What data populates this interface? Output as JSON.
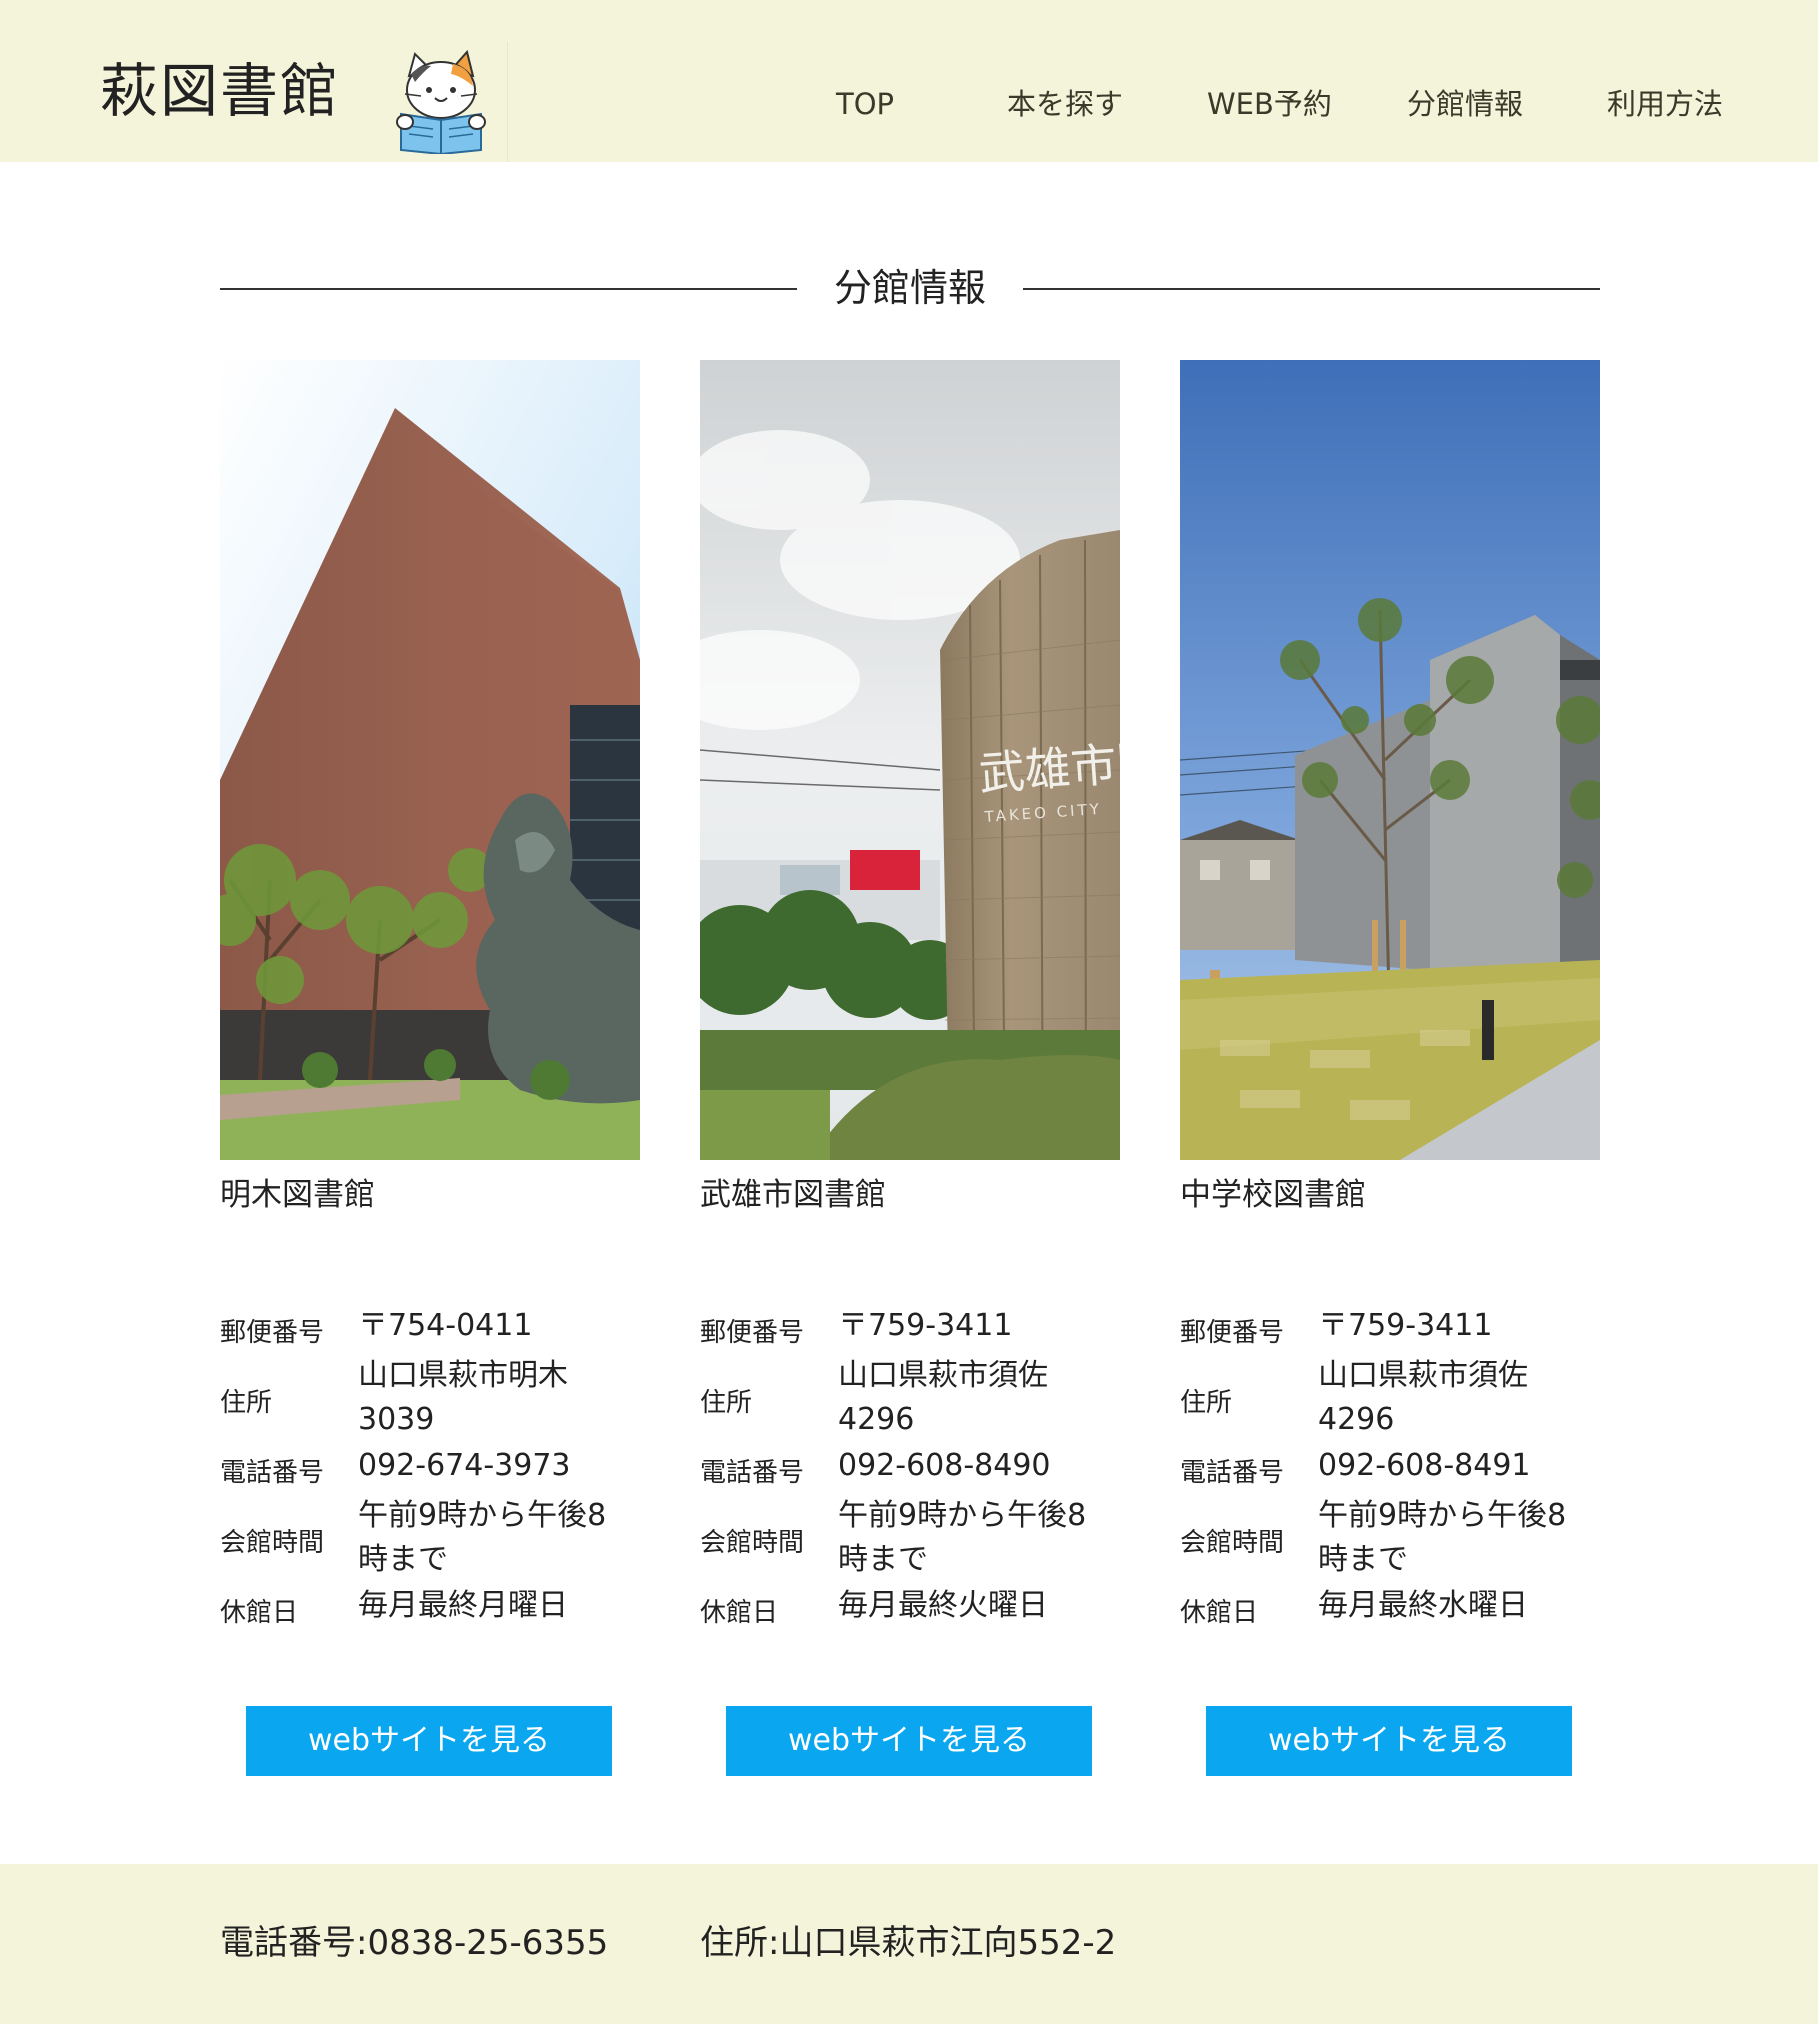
{
  "header": {
    "site_title": "萩図書館",
    "nav": [
      "TOP",
      "本を探す",
      "WEB予約",
      "分館情報",
      "利用方法"
    ]
  },
  "section": {
    "title": "分館情報"
  },
  "labels": {
    "postal": "郵便番号",
    "address": "住所",
    "phone": "電話番号",
    "hours": "会館時間",
    "closed": "休館日"
  },
  "libraries": [
    {
      "name": "明木図書館",
      "postal": "〒754-0411",
      "address": "山口県萩市明木3039",
      "phone": "092-674-3973",
      "hours": "午前9時から午後8時まで",
      "closed": "毎月最終月曜日",
      "button": "webサイトを見る"
    },
    {
      "name": "武雄市図書館",
      "postal": "〒759-3411",
      "address": "山口県萩市須佐4296",
      "phone": "092-608-8490",
      "hours": "午前9時から午後8時まで",
      "closed": "毎月最終火曜日",
      "button": "webサイトを見る"
    },
    {
      "name": "中学校図書館",
      "postal": "〒759-3411",
      "address": "山口県萩市須佐4296",
      "phone": "092-608-8491",
      "hours": "午前9時から午後8時まで",
      "closed": "毎月最終水曜日",
      "button": "webサイトを見る"
    }
  ],
  "footer": {
    "phone": "電話番号:0838-25-6355",
    "address": "住所:山口県萩市江向552-2"
  },
  "colors": {
    "header_bg": "#f4f4da",
    "button_bg": "#0aa6ef",
    "button_text": "#ffffff"
  }
}
